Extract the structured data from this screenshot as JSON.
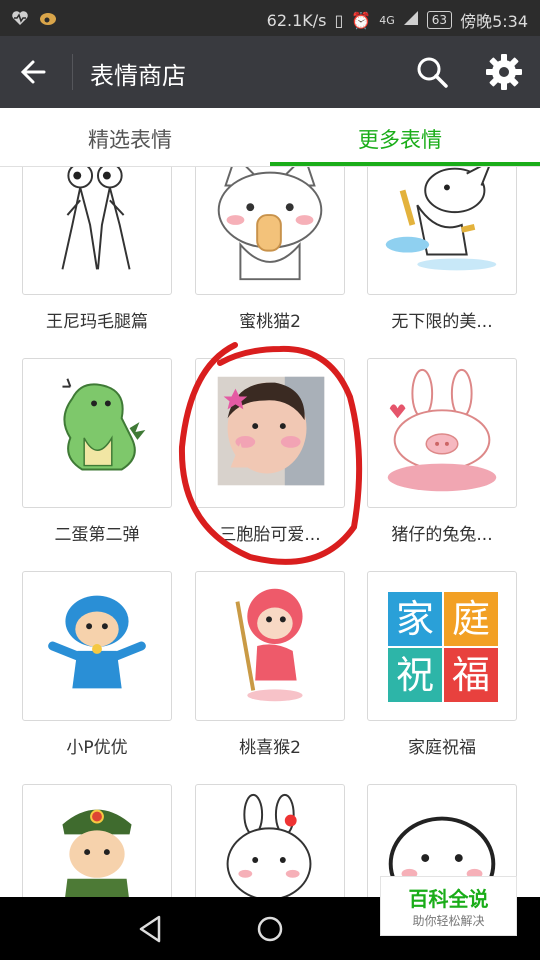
{
  "status_bar": {
    "network_speed": "62.1K/s",
    "signal": "4G",
    "battery": "63",
    "time": "傍晚5:34"
  },
  "header": {
    "title": "表情商店",
    "back_icon": "arrow-left-icon",
    "search_icon": "search-icon",
    "settings_icon": "gear-icon"
  },
  "tabs": [
    {
      "label": "精选表情",
      "active": false
    },
    {
      "label": "更多表情",
      "active": true
    }
  ],
  "accent_color": "#1aad19",
  "stickers": [
    {
      "name": "王尼玛毛腿篇"
    },
    {
      "name": "蜜桃猫2"
    },
    {
      "name": "无下限的美..."
    },
    {
      "name": "二蛋第二弹"
    },
    {
      "name": "三胞胎可爱..."
    },
    {
      "name": "猪仔的兔兔..."
    },
    {
      "name": "小P优优"
    },
    {
      "name": "桃喜猴2"
    },
    {
      "name": "家庭祝福",
      "tiles": [
        "家",
        "庭",
        "祝",
        "福"
      ]
    },
    {
      "name": ""
    },
    {
      "name": ""
    },
    {
      "name": ""
    }
  ],
  "watermark": {
    "title": "百科全说",
    "subtitle": "助你轻松解决"
  }
}
